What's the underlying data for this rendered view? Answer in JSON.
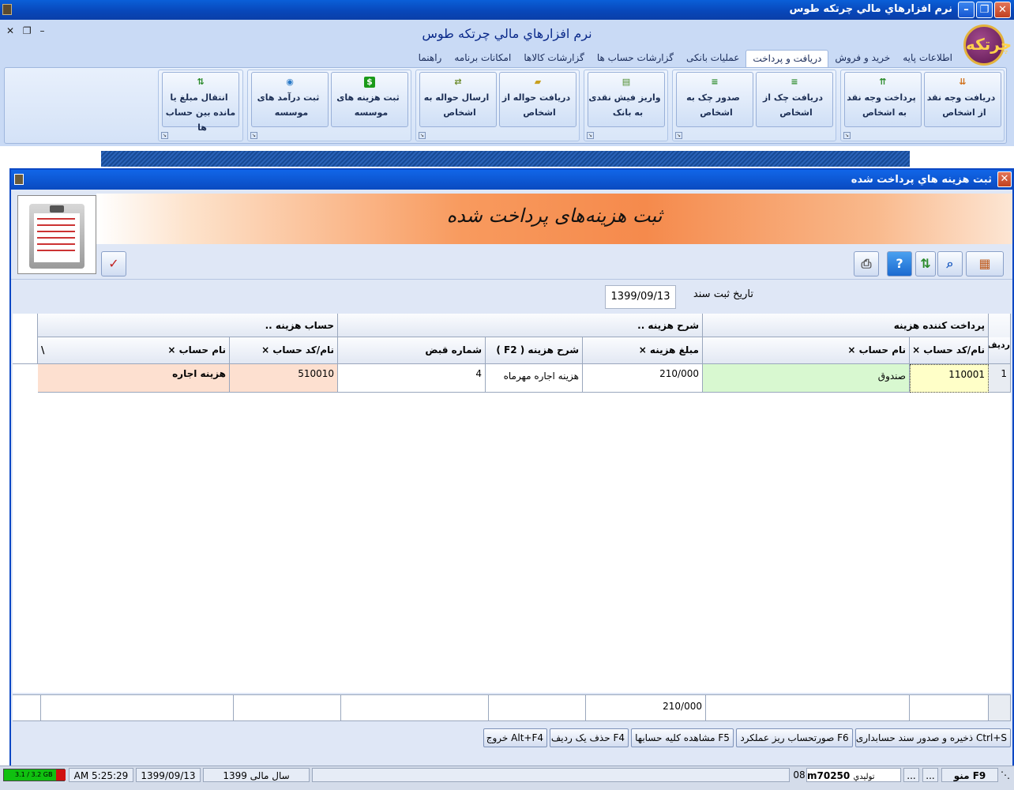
{
  "window": {
    "title": "نرم افزارهاي مالي چرتکه طوس"
  },
  "app": {
    "title": "نرم افزارهاي مالي چرتکه طوس",
    "logo_text": "چرتکه"
  },
  "tabs": [
    {
      "label": "اطلاعات پایه",
      "active": false
    },
    {
      "label": "خرید و فروش",
      "active": false
    },
    {
      "label": "دریافت و پرداخت",
      "active": true
    },
    {
      "label": "عملیات بانکی",
      "active": false
    },
    {
      "label": "گزارشات حساب ها",
      "active": false
    },
    {
      "label": "گزارشات کالاها",
      "active": false
    },
    {
      "label": "امکانات برنامه",
      "active": false
    },
    {
      "label": "راهنما",
      "active": false
    }
  ],
  "ribbon": {
    "buttons": [
      {
        "label": "دریافت وجه نقد از اشخاص",
        "icon": "cash-in-icon",
        "color": "#d0701a"
      },
      {
        "label": "پرداخت وجه نقد به اشخاص",
        "icon": "cash-out-icon",
        "color": "#2a8a2a"
      },
      {
        "label": "دریافت چک از اشخاص",
        "icon": "cheque-in-icon",
        "color": "#2a8a2a"
      },
      {
        "label": "صدور چک به اشخاص",
        "icon": "cheque-out-icon",
        "color": "#2a8a2a"
      },
      {
        "label": "واریز فیش نقدی به بانک",
        "icon": "bank-deposit-icon",
        "color": "#4a8a2a"
      },
      {
        "label": "دریافت حواله از اشخاص",
        "icon": "folder-in-icon",
        "color": "#c8a020"
      },
      {
        "label": "ارسال حواله به اشخاص",
        "icon": "transfer-out-icon",
        "color": "#6a8a2a"
      },
      {
        "label": "ثبت هزینه های موسسه",
        "icon": "dollar-icon",
        "color": "#1a9a1a"
      },
      {
        "label": "ثبت درآمد های موسسه",
        "icon": "income-icon",
        "color": "#2a7ac8"
      },
      {
        "label": "انتقال مبلغ یا مانده بین حساب ها",
        "icon": "balance-transfer-icon",
        "color": "#2a8a2a"
      }
    ]
  },
  "child_window": {
    "title": "ثبت هزينه هاي پرداخت شده",
    "banner_text": "ثبت هزینه‌های پرداخت شده"
  },
  "toolbar": {
    "buttons": [
      {
        "name": "print-icon",
        "glyph": "⎙"
      },
      {
        "name": "help-icon",
        "glyph": "?"
      },
      {
        "name": "sort-icon",
        "glyph": "⇅"
      },
      {
        "name": "search-icon",
        "glyph": "⌕"
      },
      {
        "name": "columns-icon",
        "glyph": "▦"
      }
    ],
    "spellcheck_glyph": "✓"
  },
  "form": {
    "date_label": "تاریخ ثبت سند",
    "date_value": "1399/09/13"
  },
  "grid": {
    "groups": [
      "پرداخت کننده هزینه",
      "شرح هزینه ..",
      "حساب هزینه .."
    ],
    "columns": [
      "ردیف",
      "نام/کد حساب ×",
      "نام حساب ×",
      "مبلغ هزینه ×",
      "شرح هزینه ( F2 )",
      "شماره قبض",
      "نام/کد حساب ×",
      "نام حساب ×",
      "\\"
    ],
    "rows": [
      [
        "1",
        "110001",
        "صندوق",
        "210/000",
        "هزینه اجاره مهرماه",
        "4",
        "510010",
        "هزینه اجاره",
        ""
      ]
    ],
    "total": "210/000"
  },
  "fkeys": [
    "Ctrl+S ذخیره و صدور سند حسابداری",
    "F6 صورتحساب ریز عملکرد",
    "F5 مشاهده کلیه حسابها",
    "F4 حذف یک ردیف",
    "Alt+F4 خروج"
  ],
  "status": {
    "memory": "3.1 / 3.2 GB",
    "time": "AM 5:25:29",
    "date": "1399/09/13",
    "fiscal_year": "سال مالی 1399",
    "num": "08",
    "user": "m70250",
    "user_suffix": "تولیدي",
    "menu": "F9 منو",
    "ellipsis": "..."
  },
  "colors": {
    "title_blue": "#0a4ac0",
    "ribbon_bg": "#c9daf5",
    "cell_yellow": "#ffffc8",
    "cell_green": "#d8f8d0",
    "cell_salmon": "#fde0d0"
  }
}
